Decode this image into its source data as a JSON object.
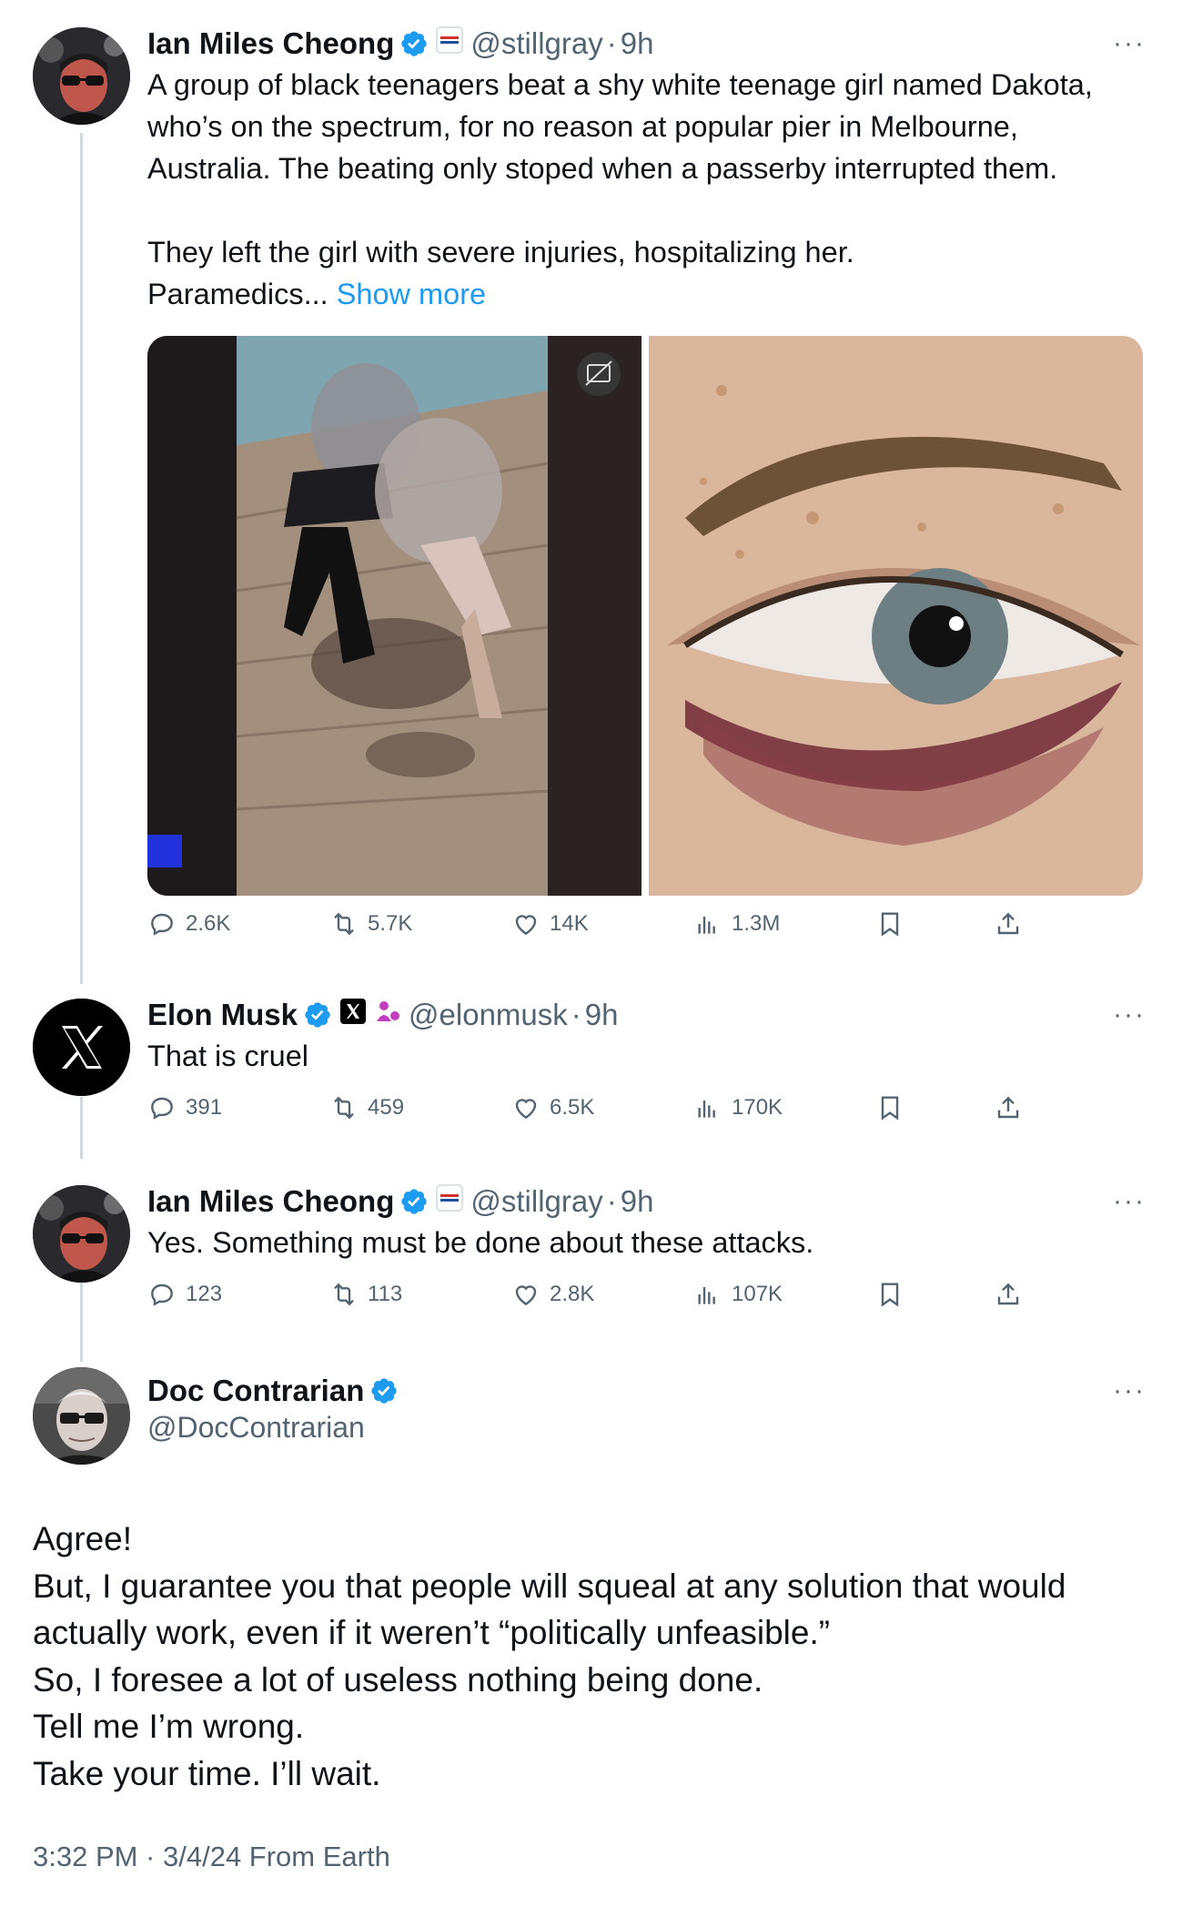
{
  "tweets": [
    {
      "name": "Ian Miles Cheong",
      "handle": "@stillgray",
      "time": "9h",
      "affiliate_badge": "REBEL NEWS",
      "text_lines": [
        "A group of black teenagers beat a shy white teenage girl named Dakota,",
        "who’s on the spectrum, for no reason at popular pier in Melbourne,",
        "Australia. The beating only stoped when a passerby interrupted them.",
        "",
        "They left the girl with severe injuries, hospitalizing her."
      ],
      "last_line": "Paramedics...",
      "show_more": "Show more",
      "stats": {
        "replies": "2.6K",
        "reposts": "5.7K",
        "likes": "14K",
        "views": "1.3M"
      }
    },
    {
      "name": "Elon Musk",
      "handle": "@elonmusk",
      "time": "9h",
      "text": "That is cruel",
      "stats": {
        "replies": "391",
        "reposts": "459",
        "likes": "6.5K",
        "views": "170K"
      }
    },
    {
      "name": "Ian Miles Cheong",
      "handle": "@stillgray",
      "time": "9h",
      "affiliate_badge": "REBEL NEWS",
      "text": "Yes. Something must be done about these attacks.",
      "stats": {
        "replies": "123",
        "reposts": "113",
        "likes": "2.8K",
        "views": "107K"
      }
    }
  ],
  "main_tweet": {
    "name": "Doc Contrarian",
    "handle": "@DocContrarian",
    "lines": [
      "Agree!",
      "But, I guarantee you that people will squeal at any solution that would",
      "actually work, even if it weren’t “politically unfeasible.”",
      "So, I foresee a lot of useless nothing being done.",
      "Tell me I’m wrong.",
      "Take your time. I’ll wait."
    ],
    "footer": "3:32 PM · 3/4/24 From Earth"
  },
  "more_label": "···",
  "colors": {
    "verified": "#1d9bf0",
    "link": "#1d9bf0",
    "muted": "#536471",
    "thread_line": "#cfd9de"
  }
}
